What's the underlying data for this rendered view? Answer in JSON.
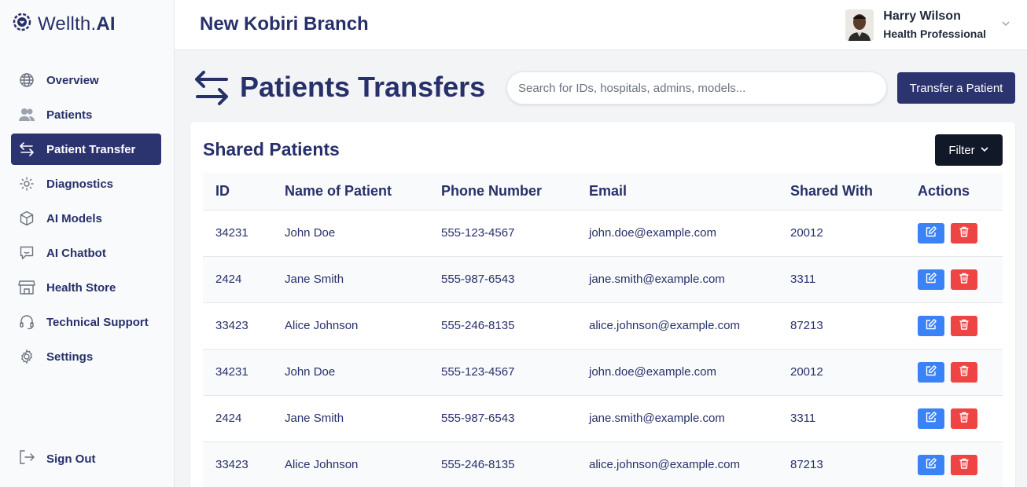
{
  "brand": {
    "name_prefix": "Wellth.",
    "name_suffix": "AI"
  },
  "header": {
    "branch": "New Kobiri Branch",
    "user_name": "Harry Wilson",
    "user_role": "Health Professional"
  },
  "sidebar": {
    "items": [
      {
        "label": "Overview",
        "icon": "globe-icon",
        "active": false
      },
      {
        "label": "Patients",
        "icon": "users-icon",
        "active": false
      },
      {
        "label": "Patient Transfer",
        "icon": "transfer-icon",
        "active": true
      },
      {
        "label": "Diagnostics",
        "icon": "gear-dots-icon",
        "active": false
      },
      {
        "label": "AI Models",
        "icon": "cube-icon",
        "active": false
      },
      {
        "label": "AI Chatbot",
        "icon": "chat-icon",
        "active": false
      },
      {
        "label": "Health Store",
        "icon": "store-icon",
        "active": false
      },
      {
        "label": "Technical Support",
        "icon": "headset-icon",
        "active": false
      },
      {
        "label": "Settings",
        "icon": "settings-icon",
        "active": false
      }
    ],
    "signout": "Sign Out"
  },
  "page": {
    "title": "Patients Transfers",
    "search_placeholder": "Search for IDs, hospitals, admins, models...",
    "transfer_button": "Transfer a Patient"
  },
  "card": {
    "title": "Shared Patients",
    "filter_label": "Filter",
    "columns": [
      "ID",
      "Name of Patient",
      "Phone Number",
      "Email",
      "Shared With",
      "Actions"
    ],
    "rows": [
      [
        "34231",
        "John Doe",
        "555-123-4567",
        "john.doe@example.com",
        "20012"
      ],
      [
        "2424",
        "Jane Smith",
        "555-987-6543",
        "jane.smith@example.com",
        "3311"
      ],
      [
        "33423",
        "Alice Johnson",
        "555-246-8135",
        "alice.johnson@example.com",
        "87213"
      ],
      [
        "34231",
        "John Doe",
        "555-123-4567",
        "john.doe@example.com",
        "20012"
      ],
      [
        "2424",
        "Jane Smith",
        "555-987-6543",
        "jane.smith@example.com",
        "3311"
      ],
      [
        "33423",
        "Alice Johnson",
        "555-246-8135",
        "alice.johnson@example.com",
        "87213"
      ]
    ]
  },
  "colors": {
    "primary": "#2c3470",
    "edit": "#3b82f6",
    "delete": "#ef4444",
    "filter": "#111827"
  }
}
